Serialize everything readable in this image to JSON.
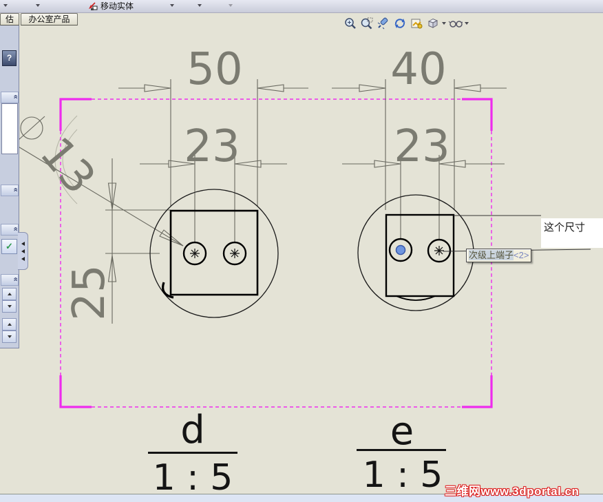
{
  "window": {
    "toolbar": {
      "command": "移动实体"
    },
    "tabs": {
      "tab_partial": "估",
      "tab_active": "办公室产品"
    }
  },
  "view_toolbar": {
    "icons": [
      "zoom-to-fit",
      "zoom-to-area",
      "zoom-previous",
      "rotate-view",
      "3d-drawing-view",
      "view-orientation",
      "display-style"
    ]
  },
  "property_panel": {
    "help": "?",
    "check": "✓"
  },
  "drawing": {
    "dimensions": {
      "overall_left": "50",
      "overall_right": "40",
      "pitch_left": "23",
      "pitch_right": "23",
      "height_left": "25",
      "diameter": "13"
    },
    "details": {
      "d": {
        "label": "d",
        "scale": "1 : 5"
      },
      "e": {
        "label": "e",
        "scale": "1 : 5"
      }
    },
    "note": {
      "text": "这个尺寸"
    },
    "tooltip": {
      "name": "次级上端子",
      "instance": "<2>"
    }
  },
  "watermark": {
    "text": "三维网www.3dportal.cn"
  },
  "colors": {
    "sheet_border_magenta": "#ee2cee",
    "dimension_gray": "#7b7b71",
    "selection_blue": "#6f96e0",
    "canvas_beige": "#e4e3d6"
  }
}
